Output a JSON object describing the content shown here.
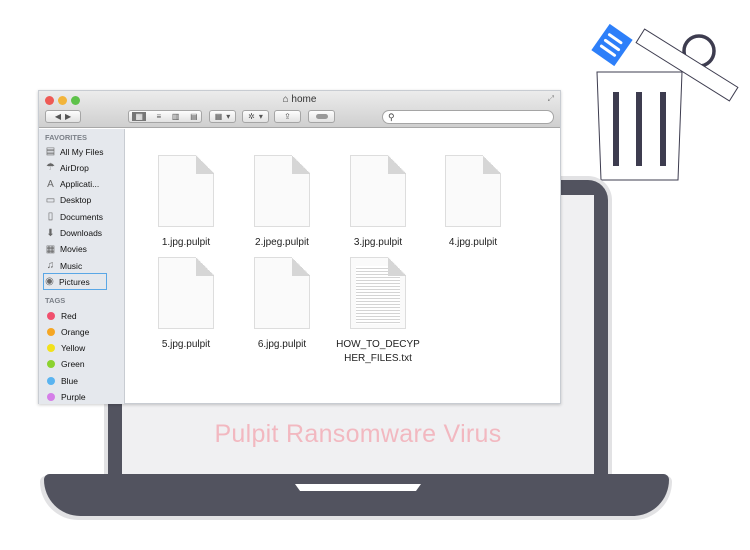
{
  "banner": {
    "title": "Pulpit Ransomware Virus"
  },
  "colors": {
    "laptop": "#52535f",
    "title_pink": "#f2b8c0",
    "trash_doc_blue": "#2d7ff9",
    "trash_stroke": "#3d3c4f"
  },
  "window": {
    "title": "home",
    "title_icon": "home-icon",
    "search": {
      "placeholder": "",
      "value": ""
    },
    "toolbar": [
      "back-icon",
      "forward-icon",
      "icon-view-icon",
      "list-view-icon",
      "column-view-icon",
      "coverflow-view-icon",
      "arrange-icon",
      "action-gear-icon",
      "share-icon",
      "tag-icon"
    ]
  },
  "sidebar": {
    "favorites_header": "FAVORITES",
    "favorites": [
      {
        "label": "All My Files",
        "icon": "files-icon"
      },
      {
        "label": "AirDrop",
        "icon": "airdrop-icon"
      },
      {
        "label": "Applicati...",
        "icon": "applications-icon"
      },
      {
        "label": "Desktop",
        "icon": "desktop-icon"
      },
      {
        "label": "Documents",
        "icon": "documents-icon"
      },
      {
        "label": "Downloads",
        "icon": "downloads-icon"
      },
      {
        "label": "Movies",
        "icon": "movies-icon"
      },
      {
        "label": "Music",
        "icon": "music-icon"
      },
      {
        "label": "Pictures",
        "icon": "camera-icon",
        "selected": true
      }
    ],
    "tags_header": "TAGS",
    "tags": [
      {
        "label": "Red",
        "color": "#f0506e"
      },
      {
        "label": "Orange",
        "color": "#f5a623"
      },
      {
        "label": "Yellow",
        "color": "#f2e11b"
      },
      {
        "label": "Green",
        "color": "#8bd22f"
      },
      {
        "label": "Blue",
        "color": "#5ab4f0"
      },
      {
        "label": "Purple",
        "color": "#d57ee8"
      }
    ]
  },
  "files": [
    {
      "name": "1.jpg.pulpit",
      "type": "blank"
    },
    {
      "name": "2.jpeg.pulpit",
      "type": "blank"
    },
    {
      "name": "3.jpg.pulpit",
      "type": "blank"
    },
    {
      "name": "4.jpg.pulpit",
      "type": "blank"
    },
    {
      "name": "5.jpg.pulpit",
      "type": "blank"
    },
    {
      "name": "6.jpg.pulpit",
      "type": "blank"
    },
    {
      "name": "HOW_TO_DECYP HER_FILES.txt",
      "type": "text"
    }
  ]
}
